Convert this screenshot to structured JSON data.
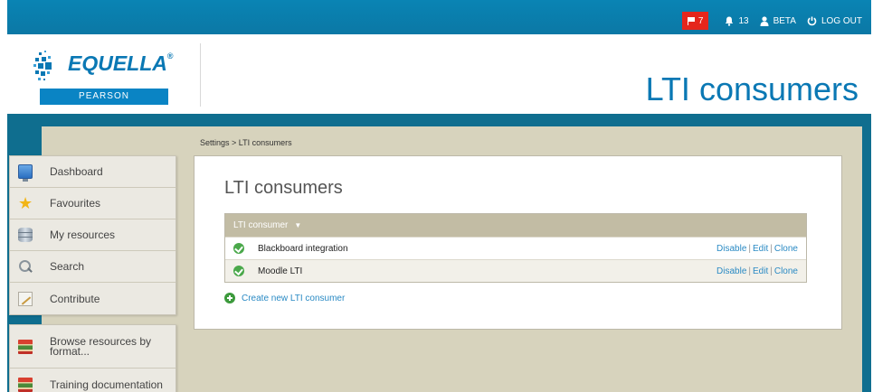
{
  "topbar": {
    "flag_count": "7",
    "notification_count": "13",
    "user_label": "BETA",
    "logout_label": "LOG OUT"
  },
  "header": {
    "logo_text": "EQUELLA",
    "logo_registered": "®",
    "logo_subtext": "PEARSON",
    "page_heading": "LTI consumers"
  },
  "breadcrumb": {
    "parent": "Settings",
    "separator": " > ",
    "current": "LTI consumers"
  },
  "sidebar": {
    "items": [
      {
        "label": "Dashboard",
        "icon": "dashboard-icon"
      },
      {
        "label": "Favourites",
        "icon": "star-icon"
      },
      {
        "label": "My resources",
        "icon": "database-icon"
      },
      {
        "label": "Search",
        "icon": "search-icon"
      },
      {
        "label": "Contribute",
        "icon": "contribute-icon"
      }
    ],
    "secondary_items": [
      {
        "label_line1": "Browse resources by",
        "label_line2": "format...",
        "icon": "books-icon"
      },
      {
        "label": "Training documentation",
        "icon": "books-icon"
      }
    ]
  },
  "panel": {
    "title": "LTI consumers",
    "column_header": "LTI consumer",
    "sort_indicator": "▼",
    "rows": [
      {
        "name": "Blackboard integration",
        "status": "enabled",
        "actions": [
          "Disable",
          "Edit",
          "Clone"
        ]
      },
      {
        "name": "Moodle LTI",
        "status": "enabled",
        "actions": [
          "Disable",
          "Edit",
          "Clone"
        ]
      }
    ],
    "create_label": "Create new LTI consumer"
  },
  "colors": {
    "brand_blue": "#0a78b4",
    "topbar_blue": "#0a84b4",
    "flag_red": "#e5261c",
    "content_bg": "#d7d3bd",
    "table_header": "#c2bca4",
    "status_green": "#4aa84a",
    "link_blue": "#2a8ac4"
  }
}
